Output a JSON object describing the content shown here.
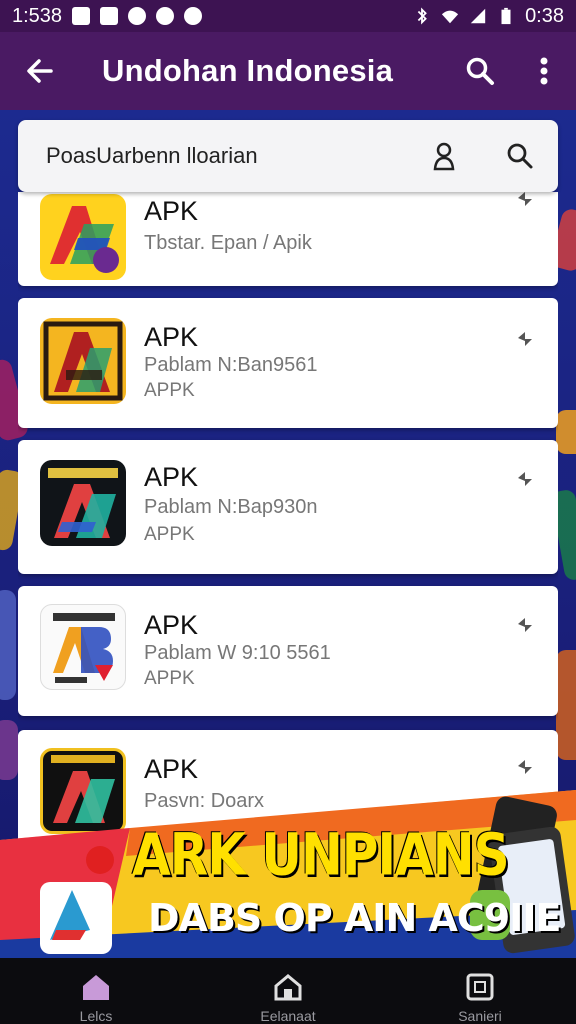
{
  "status_bar": {
    "time_left": "1:538",
    "time_right": "0:38"
  },
  "app_bar": {
    "title": "Undohan Indonesia",
    "back_icon": "arrow-left-icon",
    "search_icon": "search-icon",
    "more_icon": "more-vertical-icon"
  },
  "search": {
    "text": "PoasUarbenn lloarian",
    "profile_icon": "person-icon",
    "search_icon": "search-icon"
  },
  "items": [
    {
      "title": "APK",
      "subtitle": "Tbstar. Epan / Apik",
      "type": ""
    },
    {
      "title": "APK",
      "subtitle": "Pablam N:Ban9561",
      "type": "APPK"
    },
    {
      "title": "APK",
      "subtitle": "Pablam N:Bap930n",
      "type": "APPK"
    },
    {
      "title": "APK",
      "subtitle": "Pablam W 9:10 5561",
      "type": "APPK"
    },
    {
      "title": "APK",
      "subtitle": "Pasvn: Doarx",
      "type": ""
    }
  ],
  "banner": {
    "line1": "ARK UNPIANS",
    "line2": "DABS OP AIN AC9IIE"
  },
  "bottom_nav": [
    {
      "label": "Lelcs",
      "icon": "home-icon"
    },
    {
      "label": "Eelanaat",
      "icon": "home-outline-icon"
    },
    {
      "label": "Sanieri",
      "icon": "square-icon"
    }
  ],
  "colors": {
    "app_bar": "#4a1a63",
    "status_bar": "#3d1352",
    "background": "#1c2a8f",
    "banner_yellow": "#ffe000"
  }
}
